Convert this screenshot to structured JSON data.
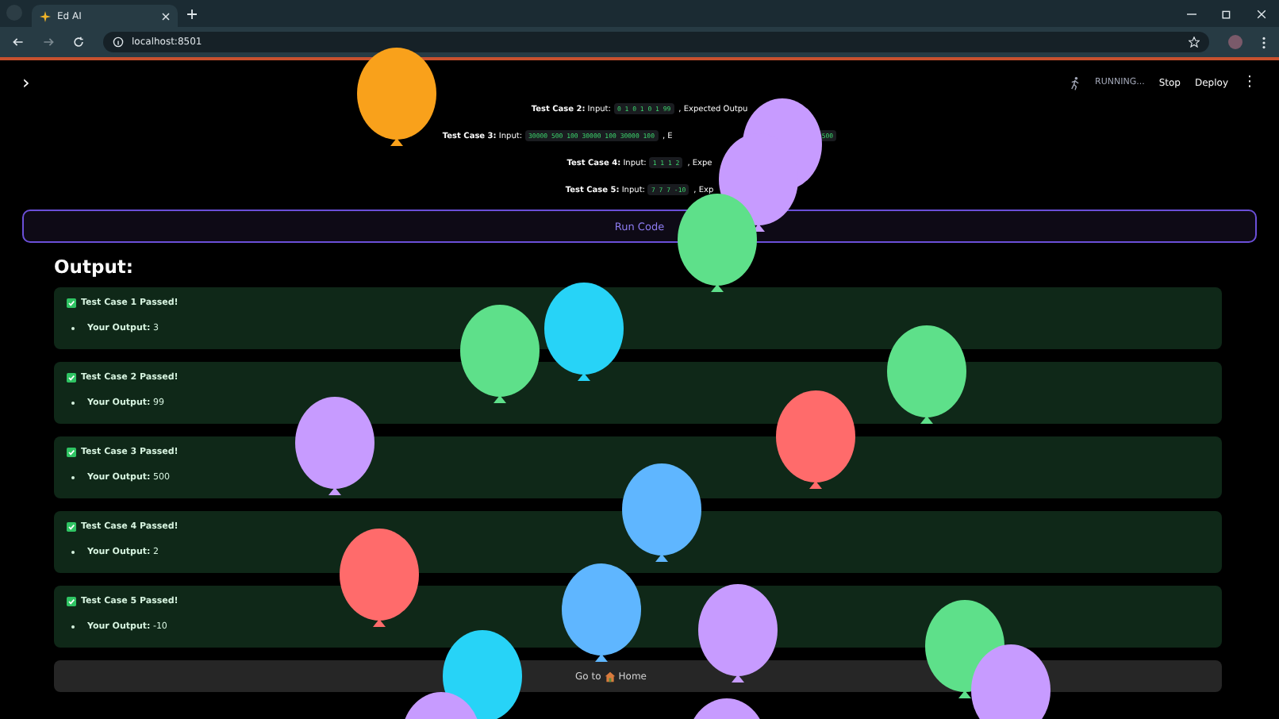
{
  "browser": {
    "tab_title": "Ed AI",
    "url": "localhost:8501"
  },
  "app_header": {
    "sidebar_toggle": "›",
    "status": "RUNNING...",
    "buttons": [
      "Stop",
      "Deploy"
    ],
    "menu": "⋮"
  },
  "test_cases": [
    {
      "label": "Test Case 2:",
      "input_label": "Input:",
      "input": "0 1 0 1 0 1 99",
      "rest": ", Expected Outpu"
    },
    {
      "label": "Test Case 3:",
      "input_label": "Input:",
      "input": "30000 500 100 30000 100 30000 100",
      "rest": ", E",
      "tail": "500"
    },
    {
      "label": "Test Case 4:",
      "input_label": "Input:",
      "input": "1 1 1 2",
      "rest": ", Expe"
    },
    {
      "label": "Test Case 5:",
      "input_label": "Input:",
      "input": "7 7 7 -10",
      "rest": ", Exp"
    }
  ],
  "run_button": "Run Code",
  "output_heading": "Output:",
  "results": [
    {
      "status": "Test Case 1 Passed!",
      "passed": true,
      "output_label": "Your Output:",
      "output": "3"
    },
    {
      "status": "Test Case 2 Passed!",
      "passed": true,
      "output_label": "Your Output:",
      "output": "99"
    },
    {
      "status": "Test Case 3 Passed!",
      "passed": true,
      "output_label": "Your Output:",
      "output": "500"
    },
    {
      "status": "Test Case 4 Passed!",
      "passed": true,
      "output_label": "Your Output:",
      "output": "2"
    },
    {
      "status": "Test Case 5 Passed!",
      "passed": true,
      "output_label": "Your Output:",
      "output": "-10"
    }
  ],
  "home_button": {
    "prefix": "Go to",
    "label": "Home"
  }
}
